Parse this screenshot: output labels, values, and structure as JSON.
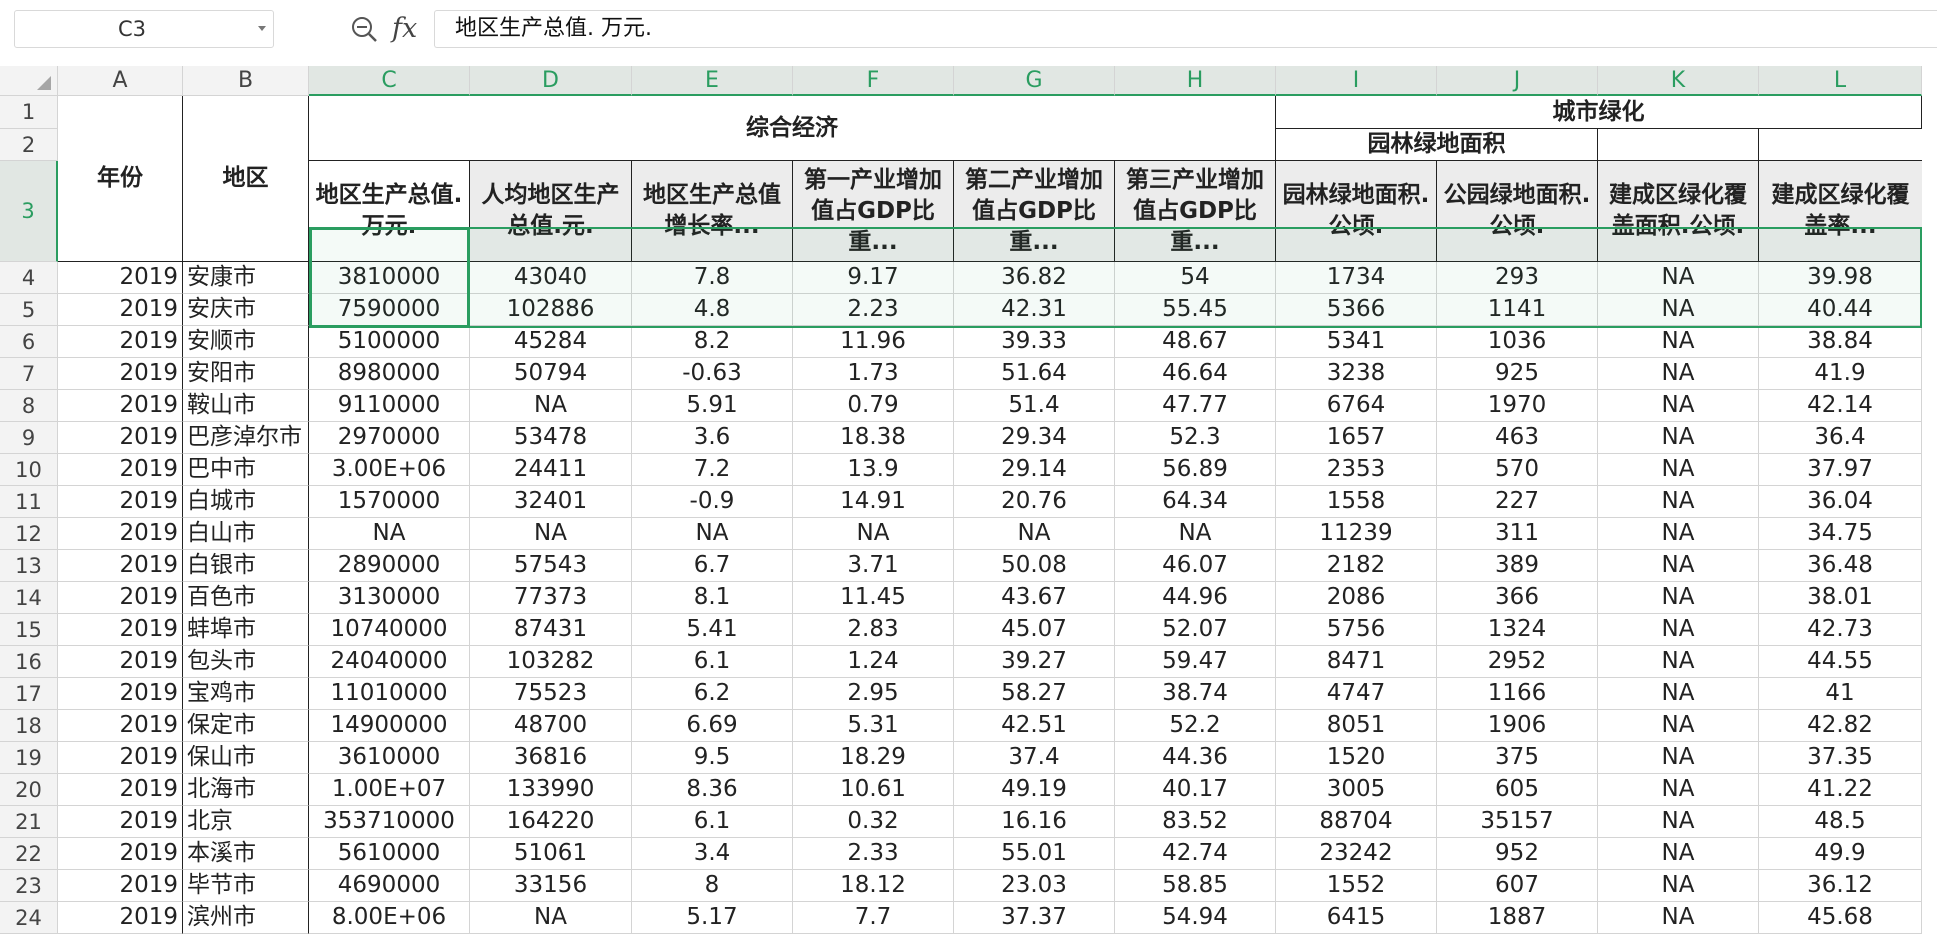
{
  "name_box": {
    "value": "C3"
  },
  "formula": {
    "fx_label": "fx",
    "value": "地区生产总值. 万元."
  },
  "columns": [
    "A",
    "B",
    "C",
    "D",
    "E",
    "F",
    "G",
    "H",
    "I",
    "J",
    "K",
    "L"
  ],
  "rows_visible": [
    "1",
    "2",
    "3",
    "4",
    "5",
    "6",
    "7",
    "8",
    "9",
    "10",
    "11",
    "12",
    "13",
    "14",
    "15",
    "16",
    "17",
    "18",
    "19",
    "20",
    "21",
    "22",
    "23",
    "24"
  ],
  "header": {
    "year": "年份",
    "region": "地区",
    "group_econ": "综合经济",
    "group_green": "城市绿化",
    "sub_green": "园林绿地面积",
    "c3": "地区生产总值.万元.",
    "d3": "人均地区生产总值.元.",
    "e3": "地区生产总值增长率...",
    "f3": "第一产业增加值占GDP比重...",
    "g3": "第二产业增加值占GDP比重...",
    "h3": "第三产业增加值占GDP比重...",
    "i3": "园林绿地面积.公顷.",
    "j3": "公园绿地面积.公顷.",
    "k3": "建成区绿化覆盖面积.公顷.",
    "l3": "建成区绿化覆盖率..."
  },
  "data_rows": [
    [
      "2019",
      "安康市",
      "3810000",
      "43040",
      "7.8",
      "9.17",
      "36.82",
      "54",
      "1734",
      "293",
      "NA",
      "39.98"
    ],
    [
      "2019",
      "安庆市",
      "7590000",
      "102886",
      "4.8",
      "2.23",
      "42.31",
      "55.45",
      "5366",
      "1141",
      "NA",
      "40.44"
    ],
    [
      "2019",
      "安顺市",
      "5100000",
      "45284",
      "8.2",
      "11.96",
      "39.33",
      "48.67",
      "5341",
      "1036",
      "NA",
      "38.84"
    ],
    [
      "2019",
      "安阳市",
      "8980000",
      "50794",
      "-0.63",
      "1.73",
      "51.64",
      "46.64",
      "3238",
      "925",
      "NA",
      "41.9"
    ],
    [
      "2019",
      "鞍山市",
      "9110000",
      "NA",
      "5.91",
      "0.79",
      "51.4",
      "47.77",
      "6764",
      "1970",
      "NA",
      "42.14"
    ],
    [
      "2019",
      "巴彦淖尔市",
      "2970000",
      "53478",
      "3.6",
      "18.38",
      "29.34",
      "52.3",
      "1657",
      "463",
      "NA",
      "36.4"
    ],
    [
      "2019",
      "巴中市",
      "3.00E+06",
      "24411",
      "7.2",
      "13.9",
      "29.14",
      "56.89",
      "2353",
      "570",
      "NA",
      "37.97"
    ],
    [
      "2019",
      "白城市",
      "1570000",
      "32401",
      "-0.9",
      "14.91",
      "20.76",
      "64.34",
      "1558",
      "227",
      "NA",
      "36.04"
    ],
    [
      "2019",
      "白山市",
      "NA",
      "NA",
      "NA",
      "NA",
      "NA",
      "NA",
      "11239",
      "311",
      "NA",
      "34.75"
    ],
    [
      "2019",
      "白银市",
      "2890000",
      "57543",
      "6.7",
      "3.71",
      "50.08",
      "46.07",
      "2182",
      "389",
      "NA",
      "36.48"
    ],
    [
      "2019",
      "百色市",
      "3130000",
      "77373",
      "8.1",
      "11.45",
      "43.67",
      "44.96",
      "2086",
      "366",
      "NA",
      "38.01"
    ],
    [
      "2019",
      "蚌埠市",
      "10740000",
      "87431",
      "5.41",
      "2.83",
      "45.07",
      "52.07",
      "5756",
      "1324",
      "NA",
      "42.73"
    ],
    [
      "2019",
      "包头市",
      "24040000",
      "103282",
      "6.1",
      "1.24",
      "39.27",
      "59.47",
      "8471",
      "2952",
      "NA",
      "44.55"
    ],
    [
      "2019",
      "宝鸡市",
      "11010000",
      "75523",
      "6.2",
      "2.95",
      "58.27",
      "38.74",
      "4747",
      "1166",
      "NA",
      "41"
    ],
    [
      "2019",
      "保定市",
      "14900000",
      "48700",
      "6.69",
      "5.31",
      "42.51",
      "52.2",
      "8051",
      "1906",
      "NA",
      "42.82"
    ],
    [
      "2019",
      "保山市",
      "3610000",
      "36816",
      "9.5",
      "18.29",
      "37.4",
      "44.36",
      "1520",
      "375",
      "NA",
      "37.35"
    ],
    [
      "2019",
      "北海市",
      "1.00E+07",
      "133990",
      "8.36",
      "10.61",
      "49.19",
      "40.17",
      "3005",
      "605",
      "NA",
      "41.22"
    ],
    [
      "2019",
      "北京",
      "353710000",
      "164220",
      "6.1",
      "0.32",
      "16.16",
      "83.52",
      "88704",
      "35157",
      "NA",
      "48.5"
    ],
    [
      "2019",
      "本溪市",
      "5610000",
      "51061",
      "3.4",
      "2.33",
      "55.01",
      "42.74",
      "23242",
      "952",
      "NA",
      "49.9"
    ],
    [
      "2019",
      "毕节市",
      "4690000",
      "33156",
      "8",
      "18.12",
      "23.03",
      "58.85",
      "1552",
      "607",
      "NA",
      "36.12"
    ],
    [
      "2019",
      "滨州市",
      "8.00E+06",
      "NA",
      "5.17",
      "7.7",
      "37.37",
      "54.94",
      "6415",
      "1887",
      "NA",
      "45.68"
    ]
  ]
}
